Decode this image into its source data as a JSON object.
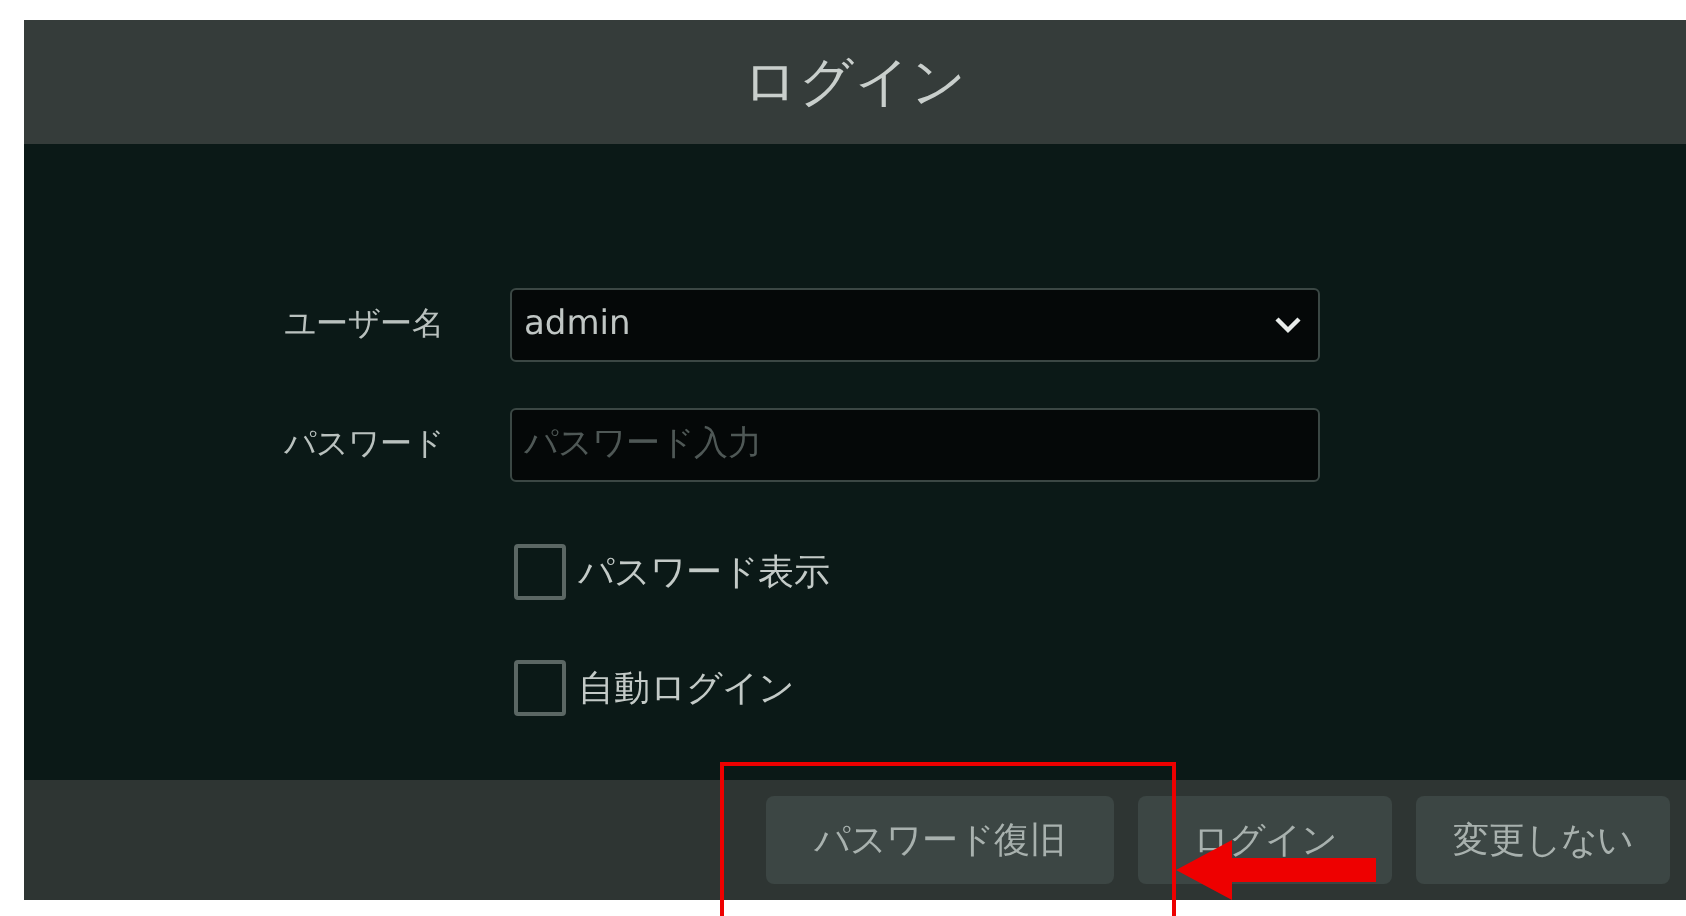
{
  "window": {
    "title": "ログイン"
  },
  "fields": [
    {
      "kind": "dropdown",
      "label": "ユーザー名",
      "value": "admin"
    },
    {
      "kind": "password",
      "label": "パスワード",
      "placeholder": "パスワード入力"
    }
  ],
  "checkboxes": [
    {
      "label": "パスワード表示",
      "checked": false
    },
    {
      "label": "自動ログイン",
      "checked": false
    }
  ],
  "buttons": [
    "パスワード復旧",
    "ログイン",
    "変更しない"
  ]
}
